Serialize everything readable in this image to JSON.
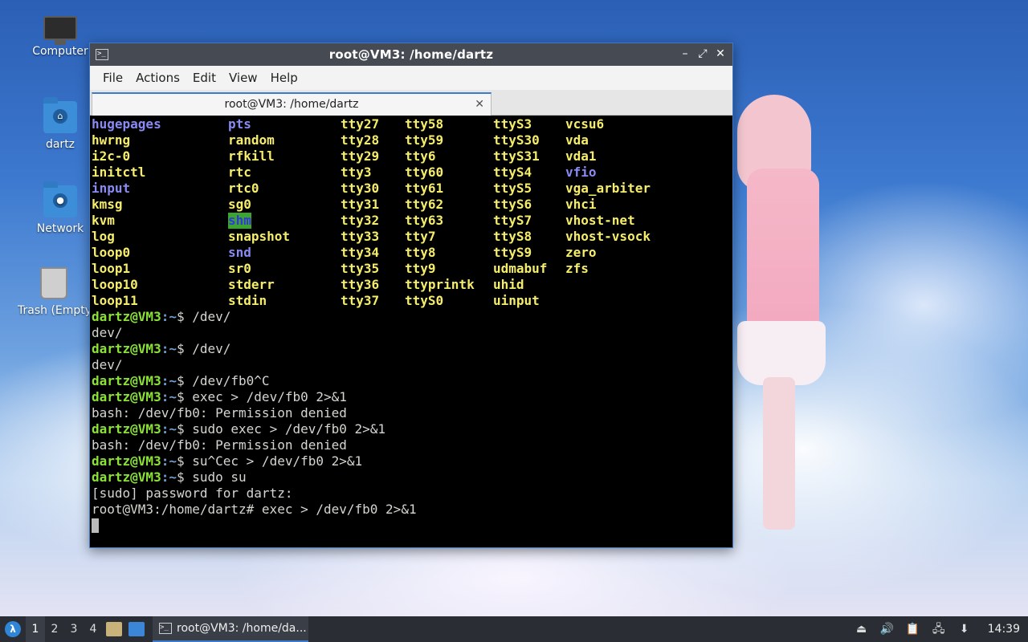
{
  "desktop": {
    "icons": [
      {
        "label": "Computer"
      },
      {
        "label": "dartz"
      },
      {
        "label": "Network"
      },
      {
        "label": "Trash (Empty)"
      }
    ]
  },
  "window": {
    "title": "root@VM3: /home/dartz",
    "menu": [
      "File",
      "Actions",
      "Edit",
      "View",
      "Help"
    ],
    "tab_title": "root@VM3: /home/dartz",
    "controls": {
      "minimize": "–",
      "maximize": "⤢",
      "close": "✕"
    }
  },
  "terminal": {
    "ls_columns": [
      [
        "hugepages",
        "hwrng",
        "i2c-0",
        "initctl",
        "input",
        "kmsg",
        "kvm",
        "log",
        "loop0",
        "loop1",
        "loop10",
        "loop11"
      ],
      [
        "pts",
        "random",
        "rfkill",
        "rtc",
        "rtc0",
        "sg0",
        "shm",
        "snapshot",
        "snd",
        "sr0",
        "stderr",
        "stdin"
      ],
      [
        "tty27",
        "tty28",
        "tty29",
        "tty3",
        "tty30",
        "tty31",
        "tty32",
        "tty33",
        "tty34",
        "tty35",
        "tty36",
        "tty37"
      ],
      [
        "tty58",
        "tty59",
        "tty6",
        "tty60",
        "tty61",
        "tty62",
        "tty63",
        "tty7",
        "tty8",
        "tty9",
        "ttyprintk",
        "ttyS0"
      ],
      [
        "ttyS3",
        "ttyS30",
        "ttyS31",
        "ttyS4",
        "ttyS5",
        "ttyS6",
        "ttyS7",
        "ttyS8",
        "ttyS9",
        "udmabuf",
        "uhid",
        "uinput"
      ],
      [
        "vcsu6",
        "vda",
        "vda1",
        "vfio",
        "vga_arbiter",
        "vhci",
        "vhost-net",
        "vhost-vsock",
        "zero",
        "zfs",
        "",
        ""
      ]
    ],
    "prompt_user": "dartz@VM3",
    "prompt_path": ":~",
    "history": [
      {
        "type": "prompt",
        "cmd": "$ /dev/"
      },
      {
        "type": "out",
        "text": "dev/"
      },
      {
        "type": "prompt",
        "cmd": "$ /dev/"
      },
      {
        "type": "out",
        "text": "dev/"
      },
      {
        "type": "prompt",
        "cmd": "$ /dev/fb0^C"
      },
      {
        "type": "prompt",
        "cmd": "$ exec > /dev/fb0 2>&1"
      },
      {
        "type": "out",
        "text": "bash: /dev/fb0: Permission denied"
      },
      {
        "type": "prompt",
        "cmd": "$ sudo exec > /dev/fb0 2>&1"
      },
      {
        "type": "out",
        "text": "bash: /dev/fb0: Permission denied"
      },
      {
        "type": "prompt",
        "cmd": "$ su^Cec > /dev/fb0 2>&1"
      },
      {
        "type": "prompt",
        "cmd": "$ sudo su"
      },
      {
        "type": "out",
        "text": "[sudo] password for dartz:"
      },
      {
        "type": "out",
        "text": "root@VM3:/home/dartz# exec > /dev/fb0 2>&1"
      }
    ]
  },
  "taskbar": {
    "workspaces": [
      "1",
      "2",
      "3",
      "4"
    ],
    "active_workspace": "1",
    "task_label": "root@VM3: /home/da...",
    "clock": "14:39"
  }
}
